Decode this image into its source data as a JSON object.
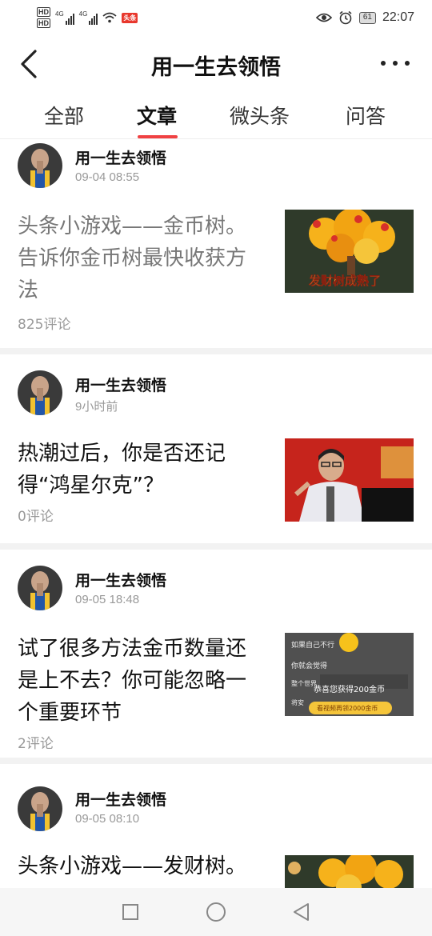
{
  "status_bar": {
    "hd1": "HD",
    "hd2": "HD",
    "net1": "4G",
    "net2": "4G",
    "news_badge": "头条",
    "battery": "61",
    "time": "22:07"
  },
  "header": {
    "title": "用一生去领悟"
  },
  "tabs": [
    {
      "label": "全部"
    },
    {
      "label": "文章"
    },
    {
      "label": "微头条"
    },
    {
      "label": "问答"
    }
  ],
  "posts": [
    {
      "author": "用一生去领悟",
      "time": "09-04 08:55",
      "title": "头条小游戏——金币树。告诉你金币树最快收获方法",
      "comments": "825评论",
      "thumb_caption": "发财树成熟了"
    },
    {
      "author": "用一生去领悟",
      "time": "9小时前",
      "title": "热潮过后，你是否还记得“鸿星尔克”？",
      "comments": "0评论"
    },
    {
      "author": "用一生去领悟",
      "time": "09-05 18:48",
      "title": "试了很多方法金币数量还是上不去？你可能忽略一个重要环节",
      "comments": "2评论",
      "thumb_line1": "如果自己不行",
      "thumb_line2": "你就会觉得",
      "thumb_line3": "整个世界",
      "thumb_line4": "恭喜您获得200金币",
      "thumb_line5": "将安",
      "thumb_button": "看视频再领2000金币"
    },
    {
      "author": "用一生去领悟",
      "time": "09-05 08:10",
      "title": "头条小游戏——发财树。",
      "comments": ""
    }
  ],
  "colors": {
    "accent": "#f04142",
    "divider": "#f2f2f2",
    "meta": "#999999"
  }
}
